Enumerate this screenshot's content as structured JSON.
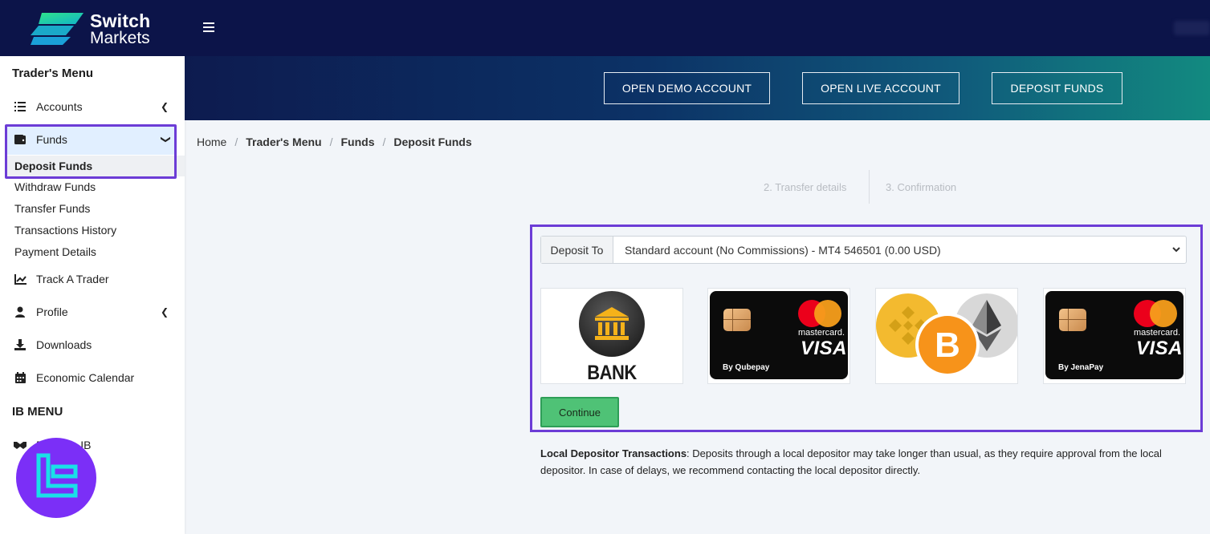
{
  "app": {
    "brand_line1": "Switch",
    "brand_line2": "Markets"
  },
  "sidebar": {
    "traders_menu_heading": "Trader's Menu",
    "items": [
      {
        "label": "Accounts",
        "icon": "list-icon"
      },
      {
        "label": "Funds",
        "icon": "wallet-icon"
      },
      {
        "label": "Track A Trader",
        "icon": "chart-line-icon"
      },
      {
        "label": "Profile",
        "icon": "user-icon"
      },
      {
        "label": "Downloads",
        "icon": "download-icon"
      },
      {
        "label": "Economic Calendar",
        "icon": "calendar-icon"
      }
    ],
    "funds_sub": [
      "Deposit Funds",
      "Withdraw Funds",
      "Transfer Funds",
      "Transactions History",
      "Payment Details"
    ],
    "ib_menu_heading": "IB MENU",
    "ib_item_label": "Become IB"
  },
  "banner": {
    "demo_label": "OPEN DEMO ACCOUNT",
    "live_label": "OPEN LIVE ACCOUNT",
    "deposit_label": "DEPOSIT FUNDS"
  },
  "breadcrumb": [
    "Home",
    "Trader's Menu",
    "Funds",
    "Deposit Funds"
  ],
  "steps": {
    "step2": "2. Transfer details",
    "step3": "3. Confirmation"
  },
  "deposit": {
    "label": "Deposit To",
    "selected_account": "Standard account (No Commissions) - MT4 546501 (0.00 USD)",
    "methods": [
      {
        "name": "bank-transfer",
        "title": "BANK TRANSFER"
      },
      {
        "name": "qubepay-card",
        "mastercard": "mastercard.",
        "visa": "VISA",
        "by": "By Qubepay"
      },
      {
        "name": "crypto"
      },
      {
        "name": "jenapay-card",
        "mastercard": "mastercard.",
        "visa": "VISA",
        "by": "By JenaPay"
      }
    ],
    "continue_label": "Continue"
  },
  "notice": {
    "title": "Local Depositor Transactions",
    "body": ": Deposits through a local depositor may take longer than usual, as they require approval from the local depositor. In case of delays, we recommend contacting the local depositor directly."
  },
  "colors": {
    "topbar": "#0c1449",
    "highlight": "#6c3cd6",
    "continue": "#4fc276"
  }
}
